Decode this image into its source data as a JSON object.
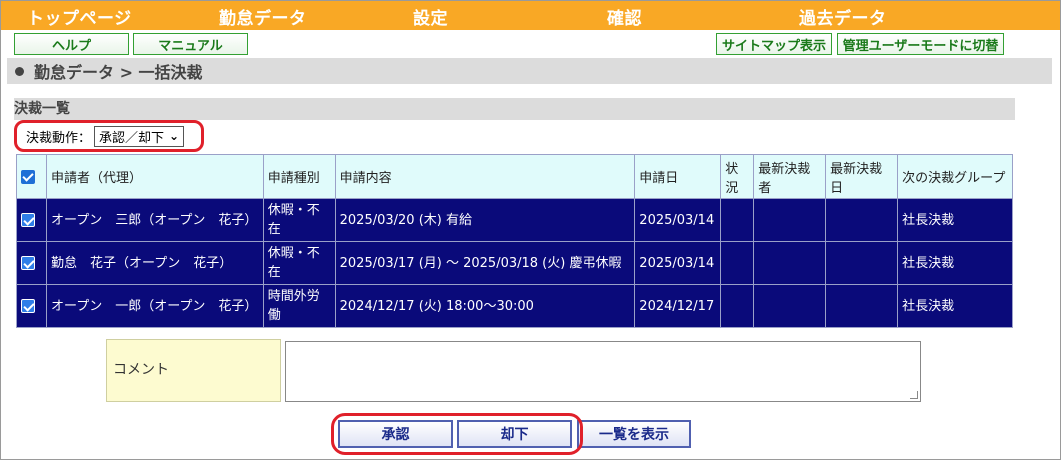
{
  "nav": {
    "items": [
      "トップページ",
      "勤怠データ",
      "設定",
      "確認",
      "過去データ"
    ]
  },
  "util": {
    "help": "ヘルプ",
    "manual": "マニュアル",
    "sitemap": "サイトマップ表示",
    "admin_mode": "管理ユーザーモードに切替"
  },
  "breadcrumb": "勤怠データ > 一括決裁",
  "section_title": "決裁一覧",
  "action": {
    "label": "決裁動作：",
    "selected": "承認／却下"
  },
  "table": {
    "headers": [
      "申請者（代理）",
      "申請種別",
      "申請内容",
      "申請日",
      "状況",
      "最新決裁者",
      "最新決裁日",
      "次の決裁グループ"
    ],
    "rows": [
      {
        "checked": true,
        "applicant": "オープン　三郎（オープン　花子）",
        "type": "休暇・不在",
        "content": "2025/03/20 (木) 有給",
        "date": "2025/03/14",
        "status": "",
        "latest_approver": "",
        "latest_date": "",
        "next_group": "社長決裁"
      },
      {
        "checked": true,
        "applicant": "勤怠　花子（オープン　花子）",
        "type": "休暇・不在",
        "content": "2025/03/17 (月) ～ 2025/03/18 (火) 慶弔休暇",
        "date": "2025/03/14",
        "status": "",
        "latest_approver": "",
        "latest_date": "",
        "next_group": "社長決裁"
      },
      {
        "checked": true,
        "applicant": "オープン　一郎（オープン　花子）",
        "type": "時間外労働",
        "content": "2024/12/17 (火) 18:00～30:00",
        "date": "2024/12/17",
        "status": "",
        "latest_approver": "",
        "latest_date": "",
        "next_group": "社長決裁"
      }
    ]
  },
  "comment": {
    "label": "コメント",
    "value": ""
  },
  "buttons": {
    "approve": "承認",
    "reject": "却下",
    "list": "一覧を表示"
  },
  "colors": {
    "nav_bg": "#f9a825",
    "row_bg": "#0a0a7a",
    "header_bg": "#e0fbfb",
    "highlight": "#e0202a"
  }
}
